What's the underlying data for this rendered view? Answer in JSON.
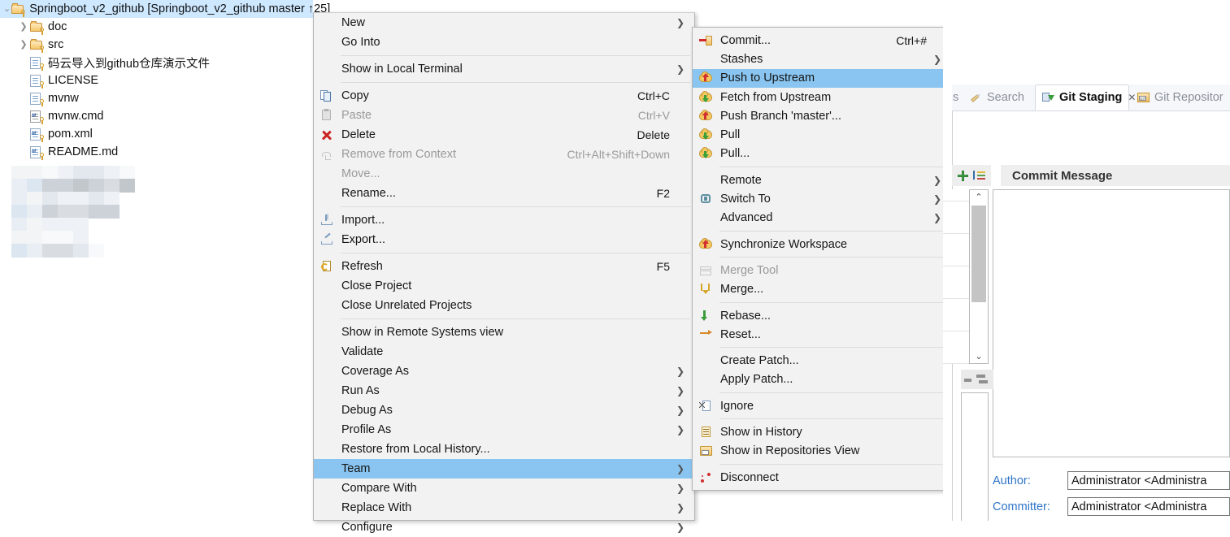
{
  "explorer": {
    "project": {
      "label": "Springboot_v2_github [Springboot_v2_github master ↑25]",
      "icon": "project-folder-icon",
      "selected": true
    },
    "children": [
      {
        "label": "doc",
        "icon": "folder-icon",
        "expandable": true
      },
      {
        "label": "src",
        "icon": "folder-icon",
        "expandable": true
      },
      {
        "label": "码云导入到github仓库演示文件",
        "icon": "file-icon",
        "expandable": false
      },
      {
        "label": "LICENSE",
        "icon": "file-icon",
        "expandable": false
      },
      {
        "label": "mvnw",
        "icon": "file-icon",
        "expandable": false
      },
      {
        "label": "mvnw.cmd",
        "icon": "file-cmd-icon",
        "expandable": false
      },
      {
        "label": "pom.xml",
        "icon": "file-xml-icon",
        "expandable": false
      },
      {
        "label": "README.md",
        "icon": "file-md-icon",
        "expandable": false
      }
    ],
    "redacted_region_label": "blurred-content"
  },
  "context_menu": {
    "name": "project-context-menu",
    "items": [
      {
        "label": "New",
        "accel": "",
        "icon": "",
        "submenu": true,
        "enabled": true,
        "sep_after": false
      },
      {
        "label": "Go Into",
        "accel": "",
        "icon": "",
        "submenu": false,
        "enabled": true,
        "sep_after": true
      },
      {
        "label": "Show in Local Terminal",
        "accel": "",
        "icon": "",
        "submenu": true,
        "enabled": true,
        "sep_after": true
      },
      {
        "label": "Copy",
        "accel": "Ctrl+C",
        "icon": "copy-icon",
        "submenu": false,
        "enabled": true,
        "sep_after": false
      },
      {
        "label": "Paste",
        "accel": "Ctrl+V",
        "icon": "paste-icon",
        "submenu": false,
        "enabled": false,
        "sep_after": false
      },
      {
        "label": "Delete",
        "accel": "Delete",
        "icon": "delete-icon",
        "submenu": false,
        "enabled": true,
        "sep_after": false
      },
      {
        "label": "Remove from Context",
        "accel": "Ctrl+Alt+Shift+Down",
        "icon": "remove-from-context-icon",
        "submenu": false,
        "enabled": false,
        "sep_after": false
      },
      {
        "label": "Move...",
        "accel": "",
        "icon": "",
        "submenu": false,
        "enabled": false,
        "sep_after": false
      },
      {
        "label": "Rename...",
        "accel": "F2",
        "icon": "",
        "submenu": false,
        "enabled": true,
        "sep_after": true
      },
      {
        "label": "Import...",
        "accel": "",
        "icon": "import-icon",
        "submenu": false,
        "enabled": true,
        "sep_after": false
      },
      {
        "label": "Export...",
        "accel": "",
        "icon": "export-icon",
        "submenu": false,
        "enabled": true,
        "sep_after": true
      },
      {
        "label": "Refresh",
        "accel": "F5",
        "icon": "refresh-icon",
        "submenu": false,
        "enabled": true,
        "sep_after": false
      },
      {
        "label": "Close Project",
        "accel": "",
        "icon": "",
        "submenu": false,
        "enabled": true,
        "sep_after": false
      },
      {
        "label": "Close Unrelated Projects",
        "accel": "",
        "icon": "",
        "submenu": false,
        "enabled": true,
        "sep_after": true
      },
      {
        "label": "Show in Remote Systems view",
        "accel": "",
        "icon": "",
        "submenu": false,
        "enabled": true,
        "sep_after": false
      },
      {
        "label": "Validate",
        "accel": "",
        "icon": "",
        "submenu": false,
        "enabled": true,
        "sep_after": false
      },
      {
        "label": "Coverage As",
        "accel": "",
        "icon": "",
        "submenu": true,
        "enabled": true,
        "sep_after": false
      },
      {
        "label": "Run As",
        "accel": "",
        "icon": "",
        "submenu": true,
        "enabled": true,
        "sep_after": false
      },
      {
        "label": "Debug As",
        "accel": "",
        "icon": "",
        "submenu": true,
        "enabled": true,
        "sep_after": false
      },
      {
        "label": "Profile As",
        "accel": "",
        "icon": "",
        "submenu": true,
        "enabled": true,
        "sep_after": false
      },
      {
        "label": "Restore from Local History...",
        "accel": "",
        "icon": "",
        "submenu": false,
        "enabled": true,
        "sep_after": false
      },
      {
        "label": "Team",
        "accel": "",
        "icon": "",
        "submenu": true,
        "enabled": true,
        "sep_after": false,
        "highlighted": true
      },
      {
        "label": "Compare With",
        "accel": "",
        "icon": "",
        "submenu": true,
        "enabled": true,
        "sep_after": false
      },
      {
        "label": "Replace With",
        "accel": "",
        "icon": "",
        "submenu": true,
        "enabled": true,
        "sep_after": false
      },
      {
        "label": "Configure",
        "accel": "",
        "icon": "",
        "submenu": true,
        "enabled": true,
        "sep_after": false
      }
    ]
  },
  "team_submenu": {
    "name": "team-submenu",
    "items": [
      {
        "label": "Commit...",
        "accel": "Ctrl+#",
        "icon": "git-commit-icon",
        "submenu": false,
        "enabled": true,
        "sep_after": false
      },
      {
        "label": "Stashes",
        "accel": "",
        "icon": "",
        "submenu": true,
        "enabled": true,
        "sep_after": false
      },
      {
        "label": "Push to Upstream",
        "accel": "",
        "icon": "cloud-push-icon",
        "submenu": false,
        "enabled": true,
        "sep_after": false,
        "highlighted": true
      },
      {
        "label": "Fetch from Upstream",
        "accel": "",
        "icon": "cloud-fetch-icon",
        "submenu": false,
        "enabled": true,
        "sep_after": false
      },
      {
        "label": "Push Branch 'master'...",
        "accel": "",
        "icon": "cloud-push-icon",
        "submenu": false,
        "enabled": true,
        "sep_after": false
      },
      {
        "label": "Pull",
        "accel": "",
        "icon": "cloud-pull-icon",
        "submenu": false,
        "enabled": true,
        "sep_after": false
      },
      {
        "label": "Pull...",
        "accel": "",
        "icon": "cloud-pull-icon",
        "submenu": false,
        "enabled": true,
        "sep_after": true
      },
      {
        "label": "Remote",
        "accel": "",
        "icon": "",
        "submenu": true,
        "enabled": true,
        "sep_after": false
      },
      {
        "label": "Switch To",
        "accel": "",
        "icon": "branch-icon",
        "submenu": true,
        "enabled": true,
        "sep_after": false
      },
      {
        "label": "Advanced",
        "accel": "",
        "icon": "",
        "submenu": true,
        "enabled": true,
        "sep_after": true
      },
      {
        "label": "Synchronize Workspace",
        "accel": "",
        "icon": "cloud-sync-icon",
        "submenu": false,
        "enabled": true,
        "sep_after": true
      },
      {
        "label": "Merge Tool",
        "accel": "",
        "icon": "merge-tool-icon",
        "submenu": false,
        "enabled": false,
        "sep_after": false
      },
      {
        "label": "Merge...",
        "accel": "",
        "icon": "merge-icon",
        "submenu": false,
        "enabled": true,
        "sep_after": true
      },
      {
        "label": "Rebase...",
        "accel": "",
        "icon": "rebase-icon",
        "submenu": false,
        "enabled": true,
        "sep_after": false
      },
      {
        "label": "Reset...",
        "accel": "",
        "icon": "reset-icon",
        "submenu": false,
        "enabled": true,
        "sep_after": true
      },
      {
        "label": "Create Patch...",
        "accel": "",
        "icon": "",
        "submenu": false,
        "enabled": true,
        "sep_after": false
      },
      {
        "label": "Apply Patch...",
        "accel": "",
        "icon": "",
        "submenu": false,
        "enabled": true,
        "sep_after": true
      },
      {
        "label": "Ignore",
        "accel": "",
        "icon": "ignore-icon",
        "submenu": false,
        "enabled": true,
        "sep_after": true
      },
      {
        "label": "Show in History",
        "accel": "",
        "icon": "history-icon",
        "submenu": false,
        "enabled": true,
        "sep_after": false
      },
      {
        "label": "Show in Repositories View",
        "accel": "",
        "icon": "git-repo-icon",
        "submenu": false,
        "enabled": true,
        "sep_after": true
      },
      {
        "label": "Disconnect",
        "accel": "",
        "icon": "disconnect-icon",
        "submenu": false,
        "enabled": true,
        "sep_after": false
      }
    ]
  },
  "right_panel": {
    "tabs": [
      {
        "label": "s",
        "icon": "",
        "active": false,
        "closable": false
      },
      {
        "label": "Search",
        "icon": "search-icon",
        "active": false,
        "closable": false
      },
      {
        "label": "Git Staging",
        "icon": "git-staging-icon",
        "active": true,
        "closable": true
      },
      {
        "label": "Git Repositor",
        "icon": "git-repo-icon",
        "active": false,
        "closable": false
      }
    ],
    "close_glyph": "✕",
    "commit_message_header": "Commit Message",
    "toolbar": {
      "add_icon": "plus-icon",
      "sort_icon": "sort-icon"
    },
    "fields": [
      {
        "label": "Author:",
        "value": "Administrator <Administra"
      },
      {
        "label": "Committer:",
        "value": "Administrator <Administra"
      }
    ],
    "scrollbar": {
      "up_glyph": "⌃",
      "down_glyph": "⌄"
    }
  },
  "colors": {
    "selection_tree": "#cde8ff",
    "menu_highlight": "#89c5f0",
    "menu_background": "#f2f2f2",
    "menu_border": "#b4b4b4",
    "disabled_text": "#9a9a9a",
    "field_label": "#2e74c8",
    "folder_icon": "#f6c86a"
  },
  "glyphs": {
    "submenu_arrow": "❯",
    "tree_collapsed": "❯",
    "tree_expanded": "⌄"
  }
}
